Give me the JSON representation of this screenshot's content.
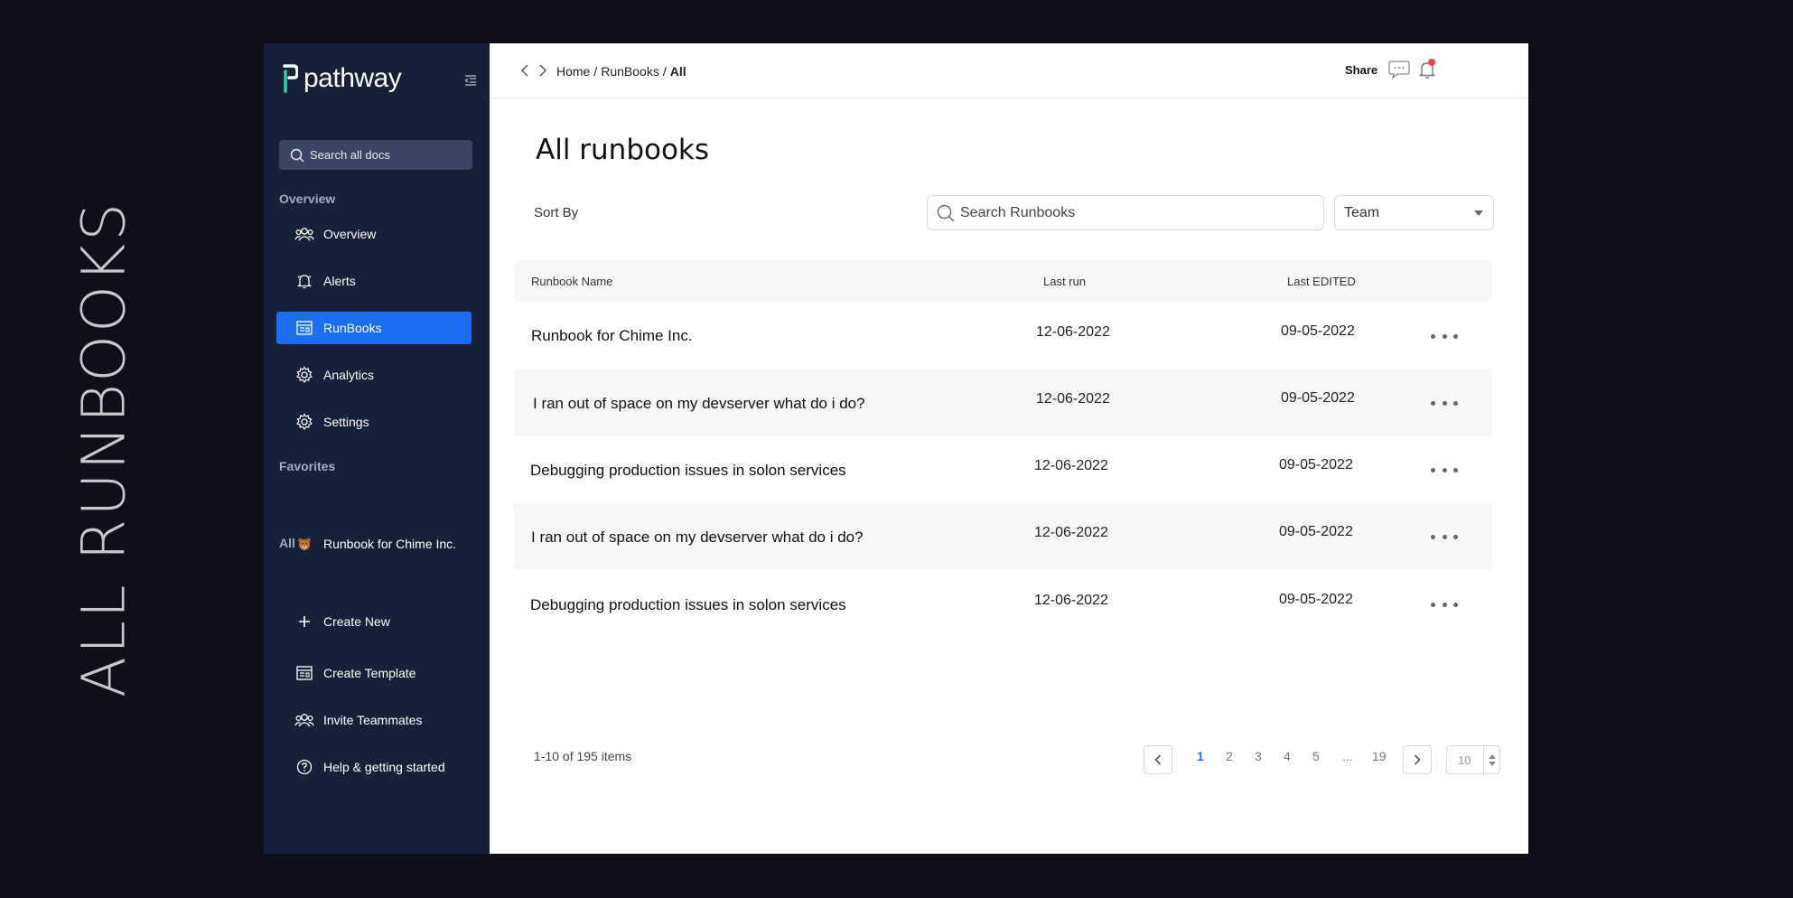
{
  "banner": {
    "title": "ALL RUNBOOKS"
  },
  "sidebar": {
    "brand": "pathway",
    "search_placeholder": "Search all docs",
    "sections": {
      "overview": "Overview",
      "favorites": "Favorites",
      "all": "All"
    },
    "nav_items": [
      {
        "label": "Overview",
        "icon": "team-icon"
      },
      {
        "label": "Alerts",
        "icon": "bell-icon"
      },
      {
        "label": "RunBooks",
        "icon": "runbook-icon",
        "active": true
      },
      {
        "label": "Analytics",
        "icon": "gear-icon"
      },
      {
        "label": "Settings",
        "icon": "gear-icon"
      }
    ],
    "favorites": [
      {
        "label": "Runbook for Chime Inc.",
        "icon": "bear-emoji-icon"
      }
    ],
    "all_items": [
      {
        "label": "Create New",
        "icon": "plus-icon"
      },
      {
        "label": "Create Template",
        "icon": "template-icon"
      },
      {
        "label": "Invite Teammates",
        "icon": "team-icon"
      },
      {
        "label": "Help & getting started",
        "icon": "help-icon"
      }
    ]
  },
  "topbar": {
    "breadcrumb": {
      "home": "Home",
      "sep": "/",
      "runbooks": "RunBooks",
      "current": "All"
    },
    "share_label": "Share"
  },
  "main": {
    "title": "All runbooks",
    "sort_by_label": "Sort By",
    "search_placeholder": "Search Runbooks",
    "team_select": "Team",
    "columns": {
      "name": "Runbook Name",
      "last_run": "Last run",
      "last_edited": "Last EDITED"
    },
    "rows": [
      {
        "name": "Runbook for Chime Inc.",
        "last_run": "12-06-2022",
        "last_edited": "09-05-2022"
      },
      {
        "name": "I ran out of space on my devserver what do i do?",
        "last_run": "12-06-2022",
        "last_edited": "09-05-2022"
      },
      {
        "name": "Debugging production issues in solon services",
        "last_run": "12-06-2022",
        "last_edited": "09-05-2022"
      },
      {
        "name": "I ran out of space on my devserver what do i do?",
        "last_run": "12-06-2022",
        "last_edited": "09-05-2022"
      },
      {
        "name": "Debugging production issues in solon services",
        "last_run": "12-06-2022",
        "last_edited": "09-05-2022"
      }
    ],
    "pagination": {
      "summary": "1-10 of 195 items",
      "pages": [
        "1",
        "2",
        "3",
        "4",
        "5",
        "...",
        "19"
      ],
      "current": "1",
      "page_size": "10"
    }
  },
  "colors": {
    "sidebar_bg": "#17203a",
    "accent": "#1b6ef0",
    "brand_green": "#2fd1a0",
    "notification": "#f0454a"
  }
}
